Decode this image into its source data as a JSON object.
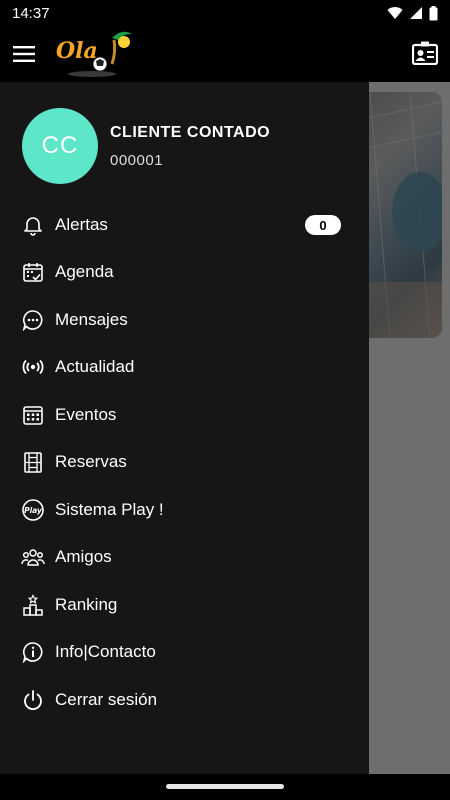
{
  "status_bar": {
    "time": "14:37"
  },
  "app_bar": {
    "logo_text": "Ola"
  },
  "drawer": {
    "user": {
      "initials": "CC",
      "name": "CLIENTE CONTADO",
      "id": "000001",
      "avatar_color": "#5ee6c8"
    },
    "items": [
      {
        "label": "Alertas",
        "icon": "bell-icon",
        "badge": "0"
      },
      {
        "label": "Agenda",
        "icon": "calendar-check-icon"
      },
      {
        "label": "Mensajes",
        "icon": "chat-bubble-icon"
      },
      {
        "label": "Actualidad",
        "icon": "broadcast-icon"
      },
      {
        "label": "Eventos",
        "icon": "calendar-grid-icon"
      },
      {
        "label": "Reservas",
        "icon": "court-icon"
      },
      {
        "label": "Sistema Play !",
        "icon": "play-badge-icon"
      },
      {
        "label": "Amigos",
        "icon": "group-icon"
      },
      {
        "label": "Ranking",
        "icon": "podium-icon"
      },
      {
        "label": "Info|Contacto",
        "icon": "info-icon"
      },
      {
        "label": "Cerrar sesión",
        "icon": "power-icon"
      }
    ]
  },
  "colors": {
    "drawer_bg": "#161616",
    "scrim": "#6e6e6e",
    "accent": "#5ee6c8"
  }
}
